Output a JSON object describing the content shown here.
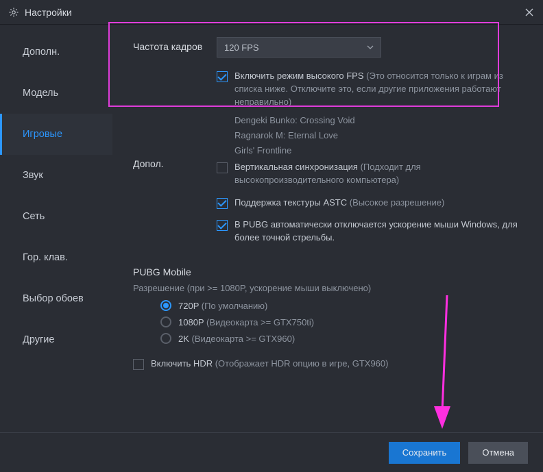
{
  "titlebar": {
    "title": "Настройки"
  },
  "sidebar": {
    "items": [
      {
        "label": "Дополн."
      },
      {
        "label": "Модель"
      },
      {
        "label": "Игровые",
        "active": true
      },
      {
        "label": "Звук"
      },
      {
        "label": "Сеть"
      },
      {
        "label": "Гор. клав."
      },
      {
        "label": "Выбор обоев"
      },
      {
        "label": "Другие"
      }
    ]
  },
  "fps": {
    "label": "Частота кадров",
    "value": "120 FPS",
    "highfps_label": "Включить режим высокого FPS",
    "highfps_note": "(Это относится только к играм из списка ниже. Отключите это, если другие приложения работают неправильно)",
    "games": [
      "Dengeki Bunko: Crossing Void",
      "Ragnarok M: Eternal Love",
      "Girls' Frontline"
    ]
  },
  "addl": {
    "label": "Допол.",
    "vsync_label": "Вертикальная синхронизация",
    "vsync_note": "(Подходит для высокопроизводительного компьютера)",
    "astc_label": "Поддержка текстуры ASTC",
    "astc_note": "(Высокое разрешение)",
    "pubg_label": "В PUBG автоматически отключается ускорение мыши Windows, для более точной стрельбы."
  },
  "pubg": {
    "title": "PUBG Mobile",
    "res_label": "Разрешение",
    "res_note": "(при >= 1080P, ускорение мыши выключено)",
    "options": [
      {
        "label": "720P",
        "note": "(По умолчанию)",
        "selected": true
      },
      {
        "label": "1080P",
        "note": "(Видеокарта >= GTX750ti)",
        "selected": false
      },
      {
        "label": "2K",
        "note": "(Видеокарта >= GTX960)",
        "selected": false
      }
    ],
    "hdr_label": "Включить HDR",
    "hdr_note": "(Отображает HDR опцию в игре, GTX960)"
  },
  "footer": {
    "save": "Сохранить",
    "cancel": "Отмена"
  }
}
